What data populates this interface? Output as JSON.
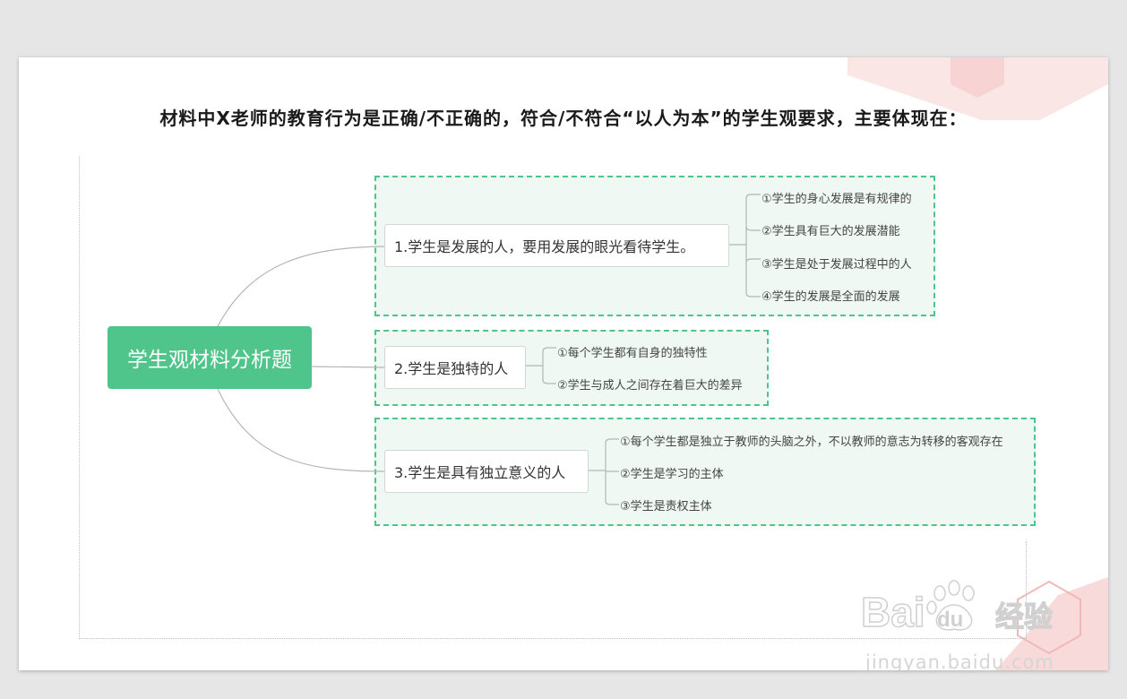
{
  "title": "材料中X老师的教育行为是正确/不正确的，符合/不符合“以人为本”的学生观要求，主要体现在：",
  "mindmap": {
    "root": "学生观材料分析题",
    "branches": [
      {
        "label": "1.学生是发展的人，要用发展的眼光看待学生。",
        "items": [
          "①学生的身心发展是有规律的",
          "②学生具有巨大的发展潜能",
          "③学生是处于发展过程中的人",
          "④学生的发展是全面的发展"
        ]
      },
      {
        "label": "2.学生是独特的人",
        "items": [
          "①每个学生都有自身的独特性",
          "②学生与成人之间存在着巨大的差异"
        ]
      },
      {
        "label": "3.学生是具有独立意义的人",
        "items": [
          "①每个学生都是独立于教师的头脑之外，不以教师的意志为转移的客观存在",
          "②学生是学习的主体",
          "③学生是责权主体"
        ]
      }
    ]
  },
  "watermark": {
    "brand": "Bai du 经验",
    "url": "jingyan.baidu.com"
  },
  "colors": {
    "accent": "#4fc48b",
    "group_bg": "#eff8f2",
    "deco": "#f8d7d7"
  }
}
